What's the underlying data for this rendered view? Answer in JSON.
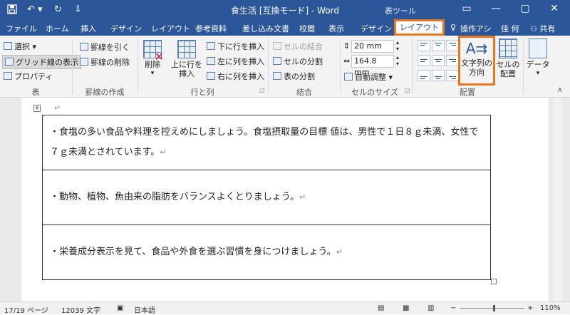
{
  "titlebar": {
    "save_icon": "save-icon",
    "undo_icon": "undo-icon",
    "redo_icon": "redo-icon",
    "customize_icon": "customize-qat-icon",
    "title": "食生活 [互換モード] - Word",
    "table_tools": "表ツール",
    "ribbon_display_icon": "ribbon-display-icon",
    "minimize": "—",
    "maximize": "▢",
    "close": "✕"
  },
  "tabs": {
    "file": "ファイル",
    "home": "ホーム",
    "insert": "挿入",
    "design": "デザイン",
    "layout": "レイアウト",
    "references": "参考資料",
    "mailings": "差し込み文書",
    "review": "校閲",
    "view": "表示",
    "table_design": "デザイン",
    "table_layout": "レイアウト",
    "tell_me": "操作アシ",
    "user": "佳 何",
    "share": "共有"
  },
  "ribbon": {
    "table": {
      "select": "選択",
      "gridlines": "グリッド線の表示",
      "properties": "プロパティ",
      "group": "表"
    },
    "draw": {
      "draw_border": "罫線を引く",
      "erase_border": "罫線の削除",
      "group": "罫線の作成"
    },
    "rows_cols": {
      "delete": "削除",
      "insert_above_1": "上に行を",
      "insert_above_2": "挿入",
      "insert_below": "下に行を挿入",
      "insert_left": "左に列を挿入",
      "insert_right": "右に列を挿入",
      "group": "行と列"
    },
    "merge": {
      "merge_cells": "セルの結合",
      "split_cells": "セルの分割",
      "split_table": "表の分割",
      "group": "結合"
    },
    "cell_size": {
      "height": "20 mm",
      "width": "164.8 mm",
      "autofit": "自動調整",
      "group": "セルのサイズ"
    },
    "alignment": {
      "text_direction_1": "文字列の",
      "text_direction_2": "方向",
      "cell_margins_1": "セルの",
      "cell_margins_2": "配置",
      "group": "配置"
    },
    "data": {
      "data": "データ"
    }
  },
  "document": {
    "row1": "・食塩の多い食品や料理を控えめにしましょう。食塩摂取量の目標 値は、男性で１日８ｇ未満、女性で７ｇ未満とされています。",
    "row2": "・動物、植物、魚由来の脂肪をバランスよくとりましょう。",
    "row3": "・栄養成分表示を見て、食品や外食を選ぶ習慣を身につけましょう。",
    "return_mark": "↵"
  },
  "statusbar": {
    "page": "17/19 ページ",
    "words": "12039 文字",
    "language": "日本語",
    "zoom": "110%"
  },
  "colors": {
    "accent": "#2b579a",
    "highlight": "#e8761c"
  }
}
